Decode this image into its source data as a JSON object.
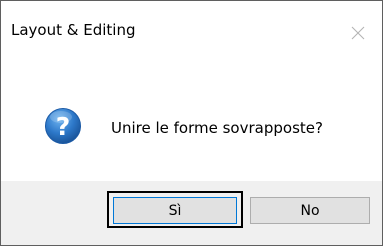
{
  "dialog": {
    "title": "Layout & Editing",
    "message": "Unire le forme sovrapposte?",
    "yes_label": "Sì",
    "no_label": "No",
    "icon": "question-icon",
    "accent_color": "#0078d7",
    "footer_color": "#f0f0f0"
  }
}
